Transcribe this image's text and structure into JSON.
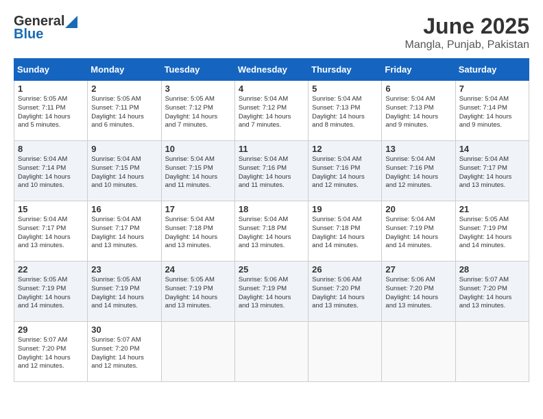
{
  "header": {
    "logo_general": "General",
    "logo_blue": "Blue",
    "title": "June 2025",
    "subtitle": "Mangla, Punjab, Pakistan"
  },
  "columns": [
    "Sunday",
    "Monday",
    "Tuesday",
    "Wednesday",
    "Thursday",
    "Friday",
    "Saturday"
  ],
  "rows": [
    [
      {
        "day": "1",
        "lines": [
          "Sunrise: 5:05 AM",
          "Sunset: 7:11 PM",
          "Daylight: 14 hours",
          "and 5 minutes."
        ]
      },
      {
        "day": "2",
        "lines": [
          "Sunrise: 5:05 AM",
          "Sunset: 7:11 PM",
          "Daylight: 14 hours",
          "and 6 minutes."
        ]
      },
      {
        "day": "3",
        "lines": [
          "Sunrise: 5:05 AM",
          "Sunset: 7:12 PM",
          "Daylight: 14 hours",
          "and 7 minutes."
        ]
      },
      {
        "day": "4",
        "lines": [
          "Sunrise: 5:04 AM",
          "Sunset: 7:12 PM",
          "Daylight: 14 hours",
          "and 7 minutes."
        ]
      },
      {
        "day": "5",
        "lines": [
          "Sunrise: 5:04 AM",
          "Sunset: 7:13 PM",
          "Daylight: 14 hours",
          "and 8 minutes."
        ]
      },
      {
        "day": "6",
        "lines": [
          "Sunrise: 5:04 AM",
          "Sunset: 7:13 PM",
          "Daylight: 14 hours",
          "and 9 minutes."
        ]
      },
      {
        "day": "7",
        "lines": [
          "Sunrise: 5:04 AM",
          "Sunset: 7:14 PM",
          "Daylight: 14 hours",
          "and 9 minutes."
        ]
      }
    ],
    [
      {
        "day": "8",
        "lines": [
          "Sunrise: 5:04 AM",
          "Sunset: 7:14 PM",
          "Daylight: 14 hours",
          "and 10 minutes."
        ]
      },
      {
        "day": "9",
        "lines": [
          "Sunrise: 5:04 AM",
          "Sunset: 7:15 PM",
          "Daylight: 14 hours",
          "and 10 minutes."
        ]
      },
      {
        "day": "10",
        "lines": [
          "Sunrise: 5:04 AM",
          "Sunset: 7:15 PM",
          "Daylight: 14 hours",
          "and 11 minutes."
        ]
      },
      {
        "day": "11",
        "lines": [
          "Sunrise: 5:04 AM",
          "Sunset: 7:16 PM",
          "Daylight: 14 hours",
          "and 11 minutes."
        ]
      },
      {
        "day": "12",
        "lines": [
          "Sunrise: 5:04 AM",
          "Sunset: 7:16 PM",
          "Daylight: 14 hours",
          "and 12 minutes."
        ]
      },
      {
        "day": "13",
        "lines": [
          "Sunrise: 5:04 AM",
          "Sunset: 7:16 PM",
          "Daylight: 14 hours",
          "and 12 minutes."
        ]
      },
      {
        "day": "14",
        "lines": [
          "Sunrise: 5:04 AM",
          "Sunset: 7:17 PM",
          "Daylight: 14 hours",
          "and 13 minutes."
        ]
      }
    ],
    [
      {
        "day": "15",
        "lines": [
          "Sunrise: 5:04 AM",
          "Sunset: 7:17 PM",
          "Daylight: 14 hours",
          "and 13 minutes."
        ]
      },
      {
        "day": "16",
        "lines": [
          "Sunrise: 5:04 AM",
          "Sunset: 7:17 PM",
          "Daylight: 14 hours",
          "and 13 minutes."
        ]
      },
      {
        "day": "17",
        "lines": [
          "Sunrise: 5:04 AM",
          "Sunset: 7:18 PM",
          "Daylight: 14 hours",
          "and 13 minutes."
        ]
      },
      {
        "day": "18",
        "lines": [
          "Sunrise: 5:04 AM",
          "Sunset: 7:18 PM",
          "Daylight: 14 hours",
          "and 13 minutes."
        ]
      },
      {
        "day": "19",
        "lines": [
          "Sunrise: 5:04 AM",
          "Sunset: 7:18 PM",
          "Daylight: 14 hours",
          "and 14 minutes."
        ]
      },
      {
        "day": "20",
        "lines": [
          "Sunrise: 5:04 AM",
          "Sunset: 7:19 PM",
          "Daylight: 14 hours",
          "and 14 minutes."
        ]
      },
      {
        "day": "21",
        "lines": [
          "Sunrise: 5:05 AM",
          "Sunset: 7:19 PM",
          "Daylight: 14 hours",
          "and 14 minutes."
        ]
      }
    ],
    [
      {
        "day": "22",
        "lines": [
          "Sunrise: 5:05 AM",
          "Sunset: 7:19 PM",
          "Daylight: 14 hours",
          "and 14 minutes."
        ]
      },
      {
        "day": "23",
        "lines": [
          "Sunrise: 5:05 AM",
          "Sunset: 7:19 PM",
          "Daylight: 14 hours",
          "and 14 minutes."
        ]
      },
      {
        "day": "24",
        "lines": [
          "Sunrise: 5:05 AM",
          "Sunset: 7:19 PM",
          "Daylight: 14 hours",
          "and 13 minutes."
        ]
      },
      {
        "day": "25",
        "lines": [
          "Sunrise: 5:06 AM",
          "Sunset: 7:19 PM",
          "Daylight: 14 hours",
          "and 13 minutes."
        ]
      },
      {
        "day": "26",
        "lines": [
          "Sunrise: 5:06 AM",
          "Sunset: 7:20 PM",
          "Daylight: 14 hours",
          "and 13 minutes."
        ]
      },
      {
        "day": "27",
        "lines": [
          "Sunrise: 5:06 AM",
          "Sunset: 7:20 PM",
          "Daylight: 14 hours",
          "and 13 minutes."
        ]
      },
      {
        "day": "28",
        "lines": [
          "Sunrise: 5:07 AM",
          "Sunset: 7:20 PM",
          "Daylight: 14 hours",
          "and 13 minutes."
        ]
      }
    ],
    [
      {
        "day": "29",
        "lines": [
          "Sunrise: 5:07 AM",
          "Sunset: 7:20 PM",
          "Daylight: 14 hours",
          "and 12 minutes."
        ]
      },
      {
        "day": "30",
        "lines": [
          "Sunrise: 5:07 AM",
          "Sunset: 7:20 PM",
          "Daylight: 14 hours",
          "and 12 minutes."
        ]
      },
      null,
      null,
      null,
      null,
      null
    ]
  ]
}
